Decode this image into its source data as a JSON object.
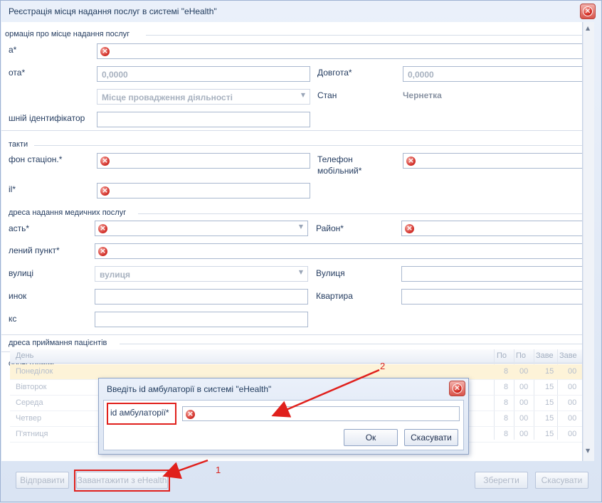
{
  "window": {
    "title": "Реєстрація місця надання послуг в системі \"eHealth\""
  },
  "sections": {
    "place_info": "ормація про місце надання послуг",
    "contacts": "такти",
    "address": "дреса надання медичних послуг",
    "reception_address": "дреса приймання пацієнтів",
    "working_hours": "обочі години"
  },
  "fields": {
    "name_label": "а*",
    "latitude_label": "ота*",
    "latitude_value": "0,0000",
    "longitude_label": "Довгота*",
    "longitude_value": "0,0000",
    "type_value": "Місце провадження діяльності",
    "status_label": "Стан",
    "status_value": "Чернетка",
    "external_id_label": "шній ідентифікатор",
    "phone_label": "фон стаціон.*",
    "mobile_label_1": "Телефон",
    "mobile_label_2": "мобільний*",
    "email_label": "il*",
    "region_label": "асть*",
    "district_label": "Район*",
    "settlement_label": "лений пункт*",
    "street_type_label": "вулиці",
    "street_type_value": "вулиця",
    "street_label": "Вулиця",
    "building_label": "инок",
    "apartment_label": "Квартира",
    "zip_label": "кс"
  },
  "grid": {
    "columns": [
      "День",
      "По",
      "По",
      "Заве",
      "Заве"
    ],
    "rows": [
      {
        "day": "Понеділок",
        "c1": "8",
        "c2": "00",
        "c3": "15",
        "c4": "00"
      },
      {
        "day": "Вівторок",
        "c1": "8",
        "c2": "00",
        "c3": "15",
        "c4": "00"
      },
      {
        "day": "Середа",
        "c1": "8",
        "c2": "00",
        "c3": "15",
        "c4": "00"
      },
      {
        "day": "Четвер",
        "c1": "8",
        "c2": "00",
        "c3": "15",
        "c4": "00"
      },
      {
        "day": "П'ятниця",
        "c1": "8",
        "c2": "00",
        "c3": "15",
        "c4": "00"
      }
    ]
  },
  "buttons": {
    "send": "Відправити",
    "load": "Завантажити з eHealth",
    "save": "Зберегти",
    "cancel": "Скасувати"
  },
  "dialog": {
    "title": "Введіть id амбулаторії в системі \"eHealth\"",
    "field_label": "id амбулаторії*",
    "ok": "Ок",
    "cancel": "Скасувати"
  },
  "annotations": {
    "one": "1",
    "two": "2"
  },
  "colors": {
    "error": "#d3312a",
    "annotation": "#e0201c",
    "selected_row": "#fdf3d8"
  }
}
